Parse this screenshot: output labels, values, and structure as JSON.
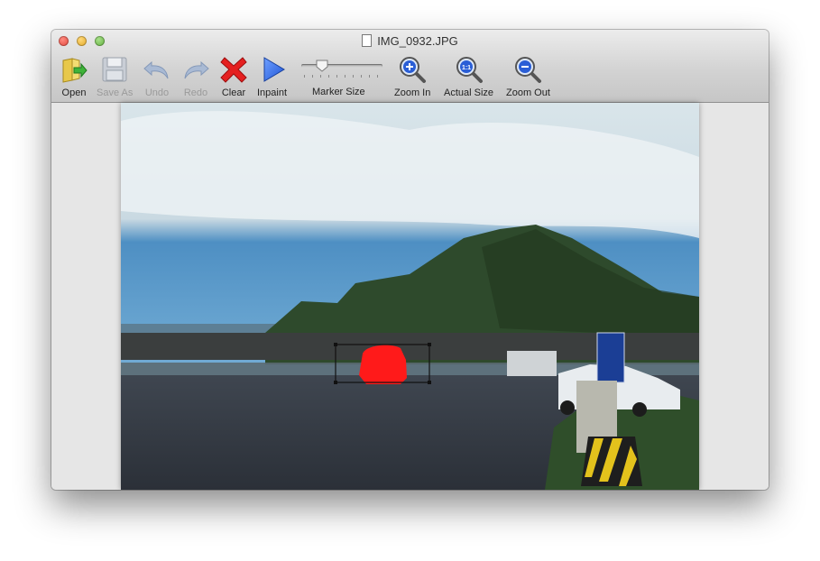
{
  "window": {
    "title": "IMG_0932.JPG"
  },
  "toolbar": {
    "open": "Open",
    "save_as": "Save As",
    "undo": "Undo",
    "redo": "Redo",
    "clear": "Clear",
    "inpaint": "Inpaint",
    "marker_size": "Marker Size",
    "zoom_in": "Zoom In",
    "actual_size": "Actual Size",
    "zoom_out": "Zoom Out",
    "marker_size_value": 0.25
  },
  "icons": {
    "open": "folder-arrow-icon",
    "save_as": "floppy-disk-icon",
    "undo": "undo-arrow-icon",
    "redo": "redo-arrow-icon",
    "clear": "red-x-icon",
    "inpaint": "play-triangle-icon",
    "zoom_in": "magnifier-plus-icon",
    "actual_size": "magnifier-1to1-icon",
    "zoom_out": "magnifier-minus-icon"
  },
  "canvas": {
    "actual_size_glyph": "1:1",
    "marker_color": "#ff1a1a"
  }
}
